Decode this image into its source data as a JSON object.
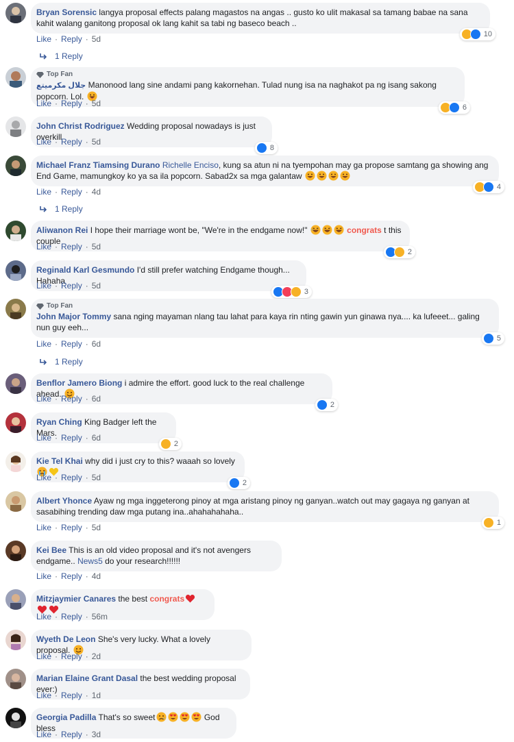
{
  "labels": {
    "like": "Like",
    "reply": "Reply",
    "top_fan": "Top Fan",
    "separator": "·"
  },
  "colors": {
    "link_blue": "#385898",
    "bubble_bg": "#f2f3f5",
    "meta_gray": "#606770",
    "congrats_red": "#f05a4f"
  },
  "comments": [
    {
      "name": "Bryan Sorensic",
      "text": "langya proposal effects palang magastos na angas .. gusto ko ulit makasal sa tamang babae na sana kahit walang ganitong proposal ok lang kahit sa tabi ng baseco beach ..",
      "reactions": [
        "haha",
        "like"
      ],
      "reaction_count": "10",
      "time": "5d",
      "replies": "1 Reply"
    },
    {
      "name": "جلال مكرميتع",
      "top_fan": true,
      "text": "Manonood lang sine andami pang kakornehan. Tulad nung isa na naghakot pa ng isang sakong popcorn. Lol.",
      "emojis": [
        "grin-tongue"
      ],
      "reactions": [
        "haha",
        "like"
      ],
      "reaction_count": "6",
      "time": "5d"
    },
    {
      "name": "John Christ Rodriguez",
      "text": "Wedding proposal nowadays is just overkill",
      "reactions": [
        "like"
      ],
      "reaction_count": "8",
      "time": "5d"
    },
    {
      "name": "Michael Franz Tiamsing Durano",
      "mention": "Richelle Enciso",
      "text": ", kung sa atun ni na tyempohan may ga propose samtang ga showing ang End Game, mamungkoy ko ya sa ila popcorn. Sabad2x sa mga galantaw",
      "emojis": [
        "grin",
        "grin",
        "grin",
        "grin"
      ],
      "reactions": [
        "haha",
        "like"
      ],
      "reaction_count": "4",
      "time": "4d",
      "replies": "1 Reply"
    },
    {
      "name": "Aliwanon Rei",
      "text": "I hope their marriage wont be, \"We're in the endgame now!\"",
      "emojis": [
        "laugh",
        "laugh",
        "laugh"
      ],
      "congrats": "congrats",
      "text_after": "t this couple",
      "reactions": [
        "like",
        "haha"
      ],
      "reaction_count": "2",
      "time": "5d"
    },
    {
      "name": "Reginald Karl Gesmundo",
      "text": "I'd still prefer watching Endgame though... Hahaha",
      "reactions": [
        "like",
        "love",
        "haha"
      ],
      "reaction_count": "3",
      "time": "5d"
    },
    {
      "name": "John Major Tommy",
      "top_fan": true,
      "text": "sana nging mayaman nlang tau lahat para kaya rin nting gawin yun ginawa nya.... ka lufeeet... galing nun guy eeh...",
      "reactions": [
        "like"
      ],
      "reaction_count": "5",
      "time": "6d",
      "replies": "1 Reply"
    },
    {
      "name": "Benflor Jamero Biong",
      "text": "i admire the effort. good luck to the real challenge ahead.",
      "emojis": [
        "smile"
      ],
      "reactions": [
        "like"
      ],
      "reaction_count": "2",
      "time": "6d"
    },
    {
      "name": "Ryan Ching",
      "text": "King Badger left the Mars.",
      "reactions": [
        "haha"
      ],
      "reaction_count": "2",
      "time": "6d"
    },
    {
      "name": "Kie Tel Khai",
      "text": "why did i just cry to this? waaah so lovely",
      "emojis": [
        "cry",
        "yellow-heart"
      ],
      "reactions": [
        "like"
      ],
      "reaction_count": "2",
      "time": "5d"
    },
    {
      "name": "Albert Yhonce",
      "text": "Ayaw ng mga inggeterong pinoy at mga aristang pinoy ng ganyan..watch out may gagaya ng ganyan at sasabihing trending daw mga putang ina..ahahahahaha..",
      "reactions": [
        "haha"
      ],
      "reaction_count": "1",
      "time": "5d"
    },
    {
      "name": "Kei Bee",
      "text": "This is an old video proposal and it's not avengers endgame..",
      "mention_after": "News5",
      "text_after": "do your research!!!!!!",
      "time": "4d"
    },
    {
      "name": "Mitzjaymier Canares",
      "text": "the best",
      "congrats": "congrats",
      "emojis_after": [
        "heart",
        "heart",
        "heart"
      ],
      "time": "56m"
    },
    {
      "name": "Wyeth De Leon",
      "text": "She's very lucky. What a lovely proposal.",
      "emojis": [
        "smile"
      ],
      "time": "2d"
    },
    {
      "name": "Marian Elaine Grant Dasal",
      "text": "the best wedding proposal ever:)",
      "time": "1d"
    },
    {
      "name": "Georgia Padilla",
      "text": "That's so sweet",
      "emojis": [
        "sad",
        "heart-eyes",
        "heart-eyes",
        "heart-eyes"
      ],
      "text_after": "God bless",
      "time": "3d"
    }
  ]
}
